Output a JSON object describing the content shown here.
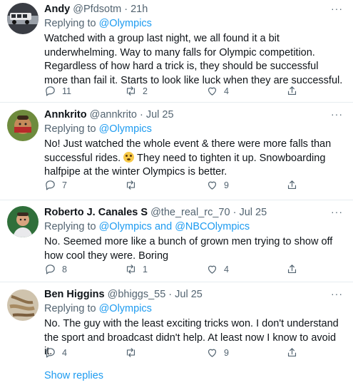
{
  "tweets": [
    {
      "name": "Andy",
      "handle": "@Pfdsotm",
      "time": "21h",
      "replying_prefix": "Replying to",
      "replying_to": "@Olympics",
      "replying_and": "",
      "replying_to2": "",
      "text": "Watched with a group last night, we all found it a bit underwhelming. Way to many falls for Olympic competition. Regardless of how hard a trick is, they should be successful more than fail it. Starts to look like luck when they are successful.",
      "text_after_emoji": "",
      "replies": "11",
      "retweets": "2",
      "likes": "4"
    },
    {
      "name": "Annkrito",
      "handle": "@annkrito",
      "time": "Jul 25",
      "replying_prefix": "Replying to",
      "replying_to": "@Olympics",
      "replying_and": "",
      "replying_to2": "",
      "text": "No!  Just watched the whole event & there were more falls than successful rides. ",
      "text_after_emoji": " They need to tighten it up.  Snowboarding halfpipe at the winter Olympics is better.",
      "replies": "7",
      "retweets": "",
      "likes": "9"
    },
    {
      "name": "Roberto J. Canales S",
      "handle": "@the_real_rc_70",
      "time": "Jul 25",
      "replying_prefix": "Replying to",
      "replying_to": "@Olympics",
      "replying_and": "and",
      "replying_to2": "@NBCOlympics",
      "text": "No. Seemed more like a bunch of grown men trying to show off how cool they were. Boring",
      "text_after_emoji": "",
      "replies": "8",
      "retweets": "1",
      "likes": "4"
    },
    {
      "name": "Ben Higgins",
      "handle": "@bhiggs_55",
      "time": "Jul 25",
      "replying_prefix": "Replying to",
      "replying_to": "@Olympics",
      "replying_and": "",
      "replying_to2": "",
      "text": "No. The guy with the least exciting tricks won. I don't understand the sport and broadcast didn't help. At least now I know to avoid it.",
      "text_after_emoji": "",
      "replies": "4",
      "retweets": "",
      "likes": "9"
    }
  ],
  "separator": "·",
  "more_glyph": "···",
  "show_replies": "Show replies",
  "colors": {
    "link": "#1d9bf0",
    "muted": "#536471",
    "text": "#0f1419",
    "divider": "#e6ecf0"
  },
  "icons": [
    "reply-icon",
    "retweet-icon",
    "like-icon",
    "share-icon",
    "more-icon",
    "grimacing-emoji"
  ]
}
